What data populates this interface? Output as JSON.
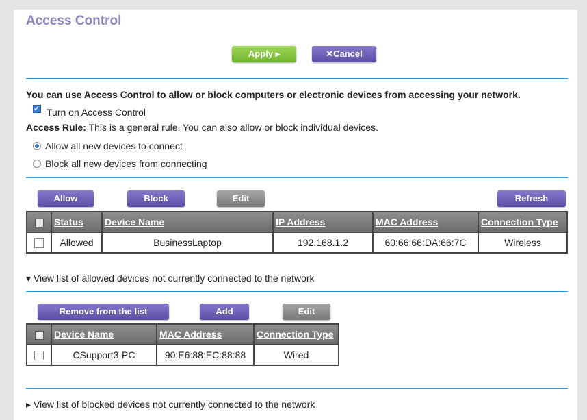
{
  "page": {
    "title": "Access Control"
  },
  "top_buttons": {
    "apply": "Apply ▸",
    "cancel": "✕Cancel"
  },
  "intro": {
    "description": "You can use Access Control to allow or block computers or electronic devices from accessing your network.",
    "turn_on_label": "Turn on Access Control",
    "turn_on_checked": true,
    "rule_label": "Access Rule:",
    "rule_text": " This is a general rule. You can also allow or block individual devices."
  },
  "rule_options": [
    {
      "label": "Allow all new devices to connect",
      "selected": true
    },
    {
      "label": "Block all new devices from connecting",
      "selected": false
    }
  ],
  "connected": {
    "buttons": {
      "allow": "Allow",
      "block": "Block",
      "edit": "Edit",
      "refresh": "Refresh"
    },
    "columns": [
      "Status",
      "Device Name",
      "IP Address",
      "MAC Address",
      "Connection Type"
    ],
    "rows": [
      {
        "status": "Allowed",
        "device_name": "BusinessLaptop",
        "ip": "192.168.1.2",
        "mac": "60:66:66:DA:66:7C",
        "connection": "Wireless"
      }
    ]
  },
  "allowed_not_connected": {
    "toggle": "▾ View list of allowed devices not currently connected to the network",
    "buttons": {
      "remove": "Remove from the list",
      "add": "Add",
      "edit": "Edit"
    },
    "columns": [
      "Device Name",
      "MAC Address",
      "Connection Type"
    ],
    "rows": [
      {
        "device_name": "CSupport3-PC",
        "mac": "90:E6:88:EC:88:88",
        "connection": "Wired"
      }
    ]
  },
  "blocked_not_connected": {
    "toggle": "▸ View list of blocked devices not currently connected to the network"
  },
  "colors": {
    "accent_blue": "#2e9ad6",
    "title_purple": "#8a84c2",
    "apply_green": "#7cc23a",
    "button_purple": "#6b5fb8",
    "allowed_green": "#2f8f2f"
  }
}
